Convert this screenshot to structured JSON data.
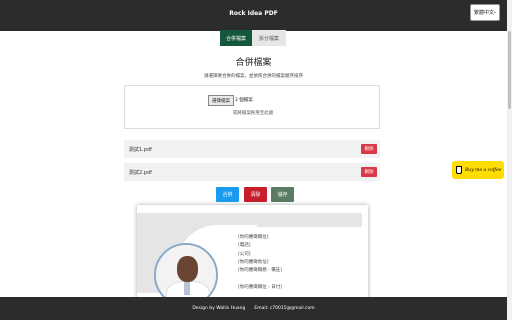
{
  "header": {
    "title": "Rock Idea PDF",
    "language": "繁體中文"
  },
  "tabs": [
    {
      "label": "合併檔案",
      "active": true
    },
    {
      "label": "拆分檔案",
      "active": false
    }
  ],
  "main": {
    "heading": "合併檔案",
    "subtext": "請選擇要合併的檔案，並依照合併的檔案順序排序",
    "pick_button": "選擇檔案",
    "file_count": "2 個檔案",
    "drop_hint": "或將檔案拖曳至此處"
  },
  "files": [
    {
      "name": "測試1.pdf",
      "delete_label": "刪除"
    },
    {
      "name": "測試2.pdf",
      "delete_label": "刪除"
    }
  ],
  "actions": {
    "merge": "合併",
    "clear": "清除",
    "show": "儲存"
  },
  "preview": {
    "lines": [
      "[你的應徵職位]",
      "[電話]",
      "[公司]",
      "[你的應徵地址]",
      "[你的應徵職務 - 備註]",
      "",
      "[你的應徵職位 - 日付]"
    ]
  },
  "coffee": {
    "label": "Buy me a coffee"
  },
  "footer": {
    "credit": "Design by Wallis Huang",
    "email": "Email: c70015@gmail.com"
  },
  "colors": {
    "topbar": "#2c2c2c",
    "tab_active": "#15573b",
    "merge": "#1a9bf0",
    "clear": "#c81e2a",
    "show": "#5b7b62",
    "delete": "#d9384a",
    "coffee": "#ffdd00"
  }
}
